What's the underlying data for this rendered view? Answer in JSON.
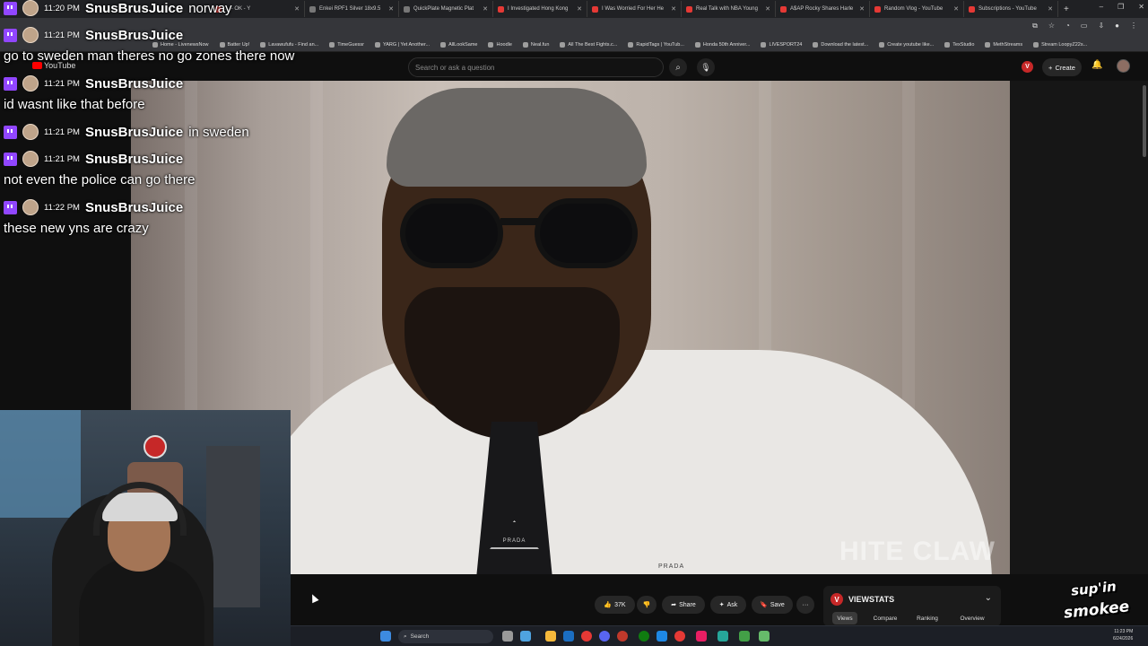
{
  "browser": {
    "tabs": [
      {
        "title": "... - OK - Y",
        "icon": "youtube-favicon"
      },
      {
        "title": "Enkei RPF1 Silver 18x9.5",
        "icon": "page-favicon"
      },
      {
        "title": "QuickPlate Magnetic Plat",
        "icon": "page-favicon"
      },
      {
        "title": "I Investigated Hong Kong",
        "icon": "youtube-favicon"
      },
      {
        "title": "I Was Worried For Her He",
        "icon": "youtube-favicon"
      },
      {
        "title": "Real Talk with NBA Young",
        "icon": "youtube-favicon"
      },
      {
        "title": "A$AP Rocky Shares Harle",
        "icon": "youtube-favicon"
      },
      {
        "title": "Random Vlog - YouTube",
        "icon": "youtube-favicon"
      },
      {
        "title": "Subscriptions - YouTube",
        "icon": "youtube-favicon"
      }
    ],
    "bookmarks": [
      "Home - LivenewsNow",
      "Batter Up!",
      "Lavawufufu - Find an...",
      "TimeGuessr",
      "YARG | Yet Another...",
      "AllLookSame",
      "Hoodle",
      "Neal.fun",
      "All The Best Fights.c...",
      "RapidTags | YouTub...",
      "Honda 50th Anniver...",
      "LIVESPORT24",
      "Download the latest...",
      "Create youtube like...",
      "TexStudio",
      "MethStreams",
      "Stream LoopyZ22s..."
    ]
  },
  "youtube": {
    "logo_text": "YouTube",
    "search_placeholder": "Search or ask a question",
    "create_label": "Create",
    "actions": {
      "like_count": "37K",
      "share_label": "Share",
      "ask_label": "Ask",
      "save_label": "Save",
      "more_label": "···"
    },
    "video": {
      "watermark": "HITE CLAW",
      "tie_logo": "PRADA",
      "pocket_logo": "PRADA"
    }
  },
  "viewstats": {
    "badge": "V",
    "title": "VIEWSTATS",
    "tabs": [
      "Views",
      "Compare",
      "Ranking",
      "Overview"
    ],
    "active_tab": "Views"
  },
  "chat": {
    "messages": [
      {
        "time": "11:20 PM",
        "user": "SnusBrusJuice",
        "inline": "norway",
        "text": ""
      },
      {
        "time": "11:21 PM",
        "user": "SnusBrusJuice",
        "inline": "",
        "text": "go to sweden man theres no go zones there now"
      },
      {
        "time": "11:21 PM",
        "user": "SnusBrusJuice",
        "inline": "",
        "text": "id wasnt like that before"
      },
      {
        "time": "11:21 PM",
        "user": "SnusBrusJuice",
        "inline": "in sweden",
        "text": ""
      },
      {
        "time": "11:21 PM",
        "user": "SnusBrusJuice",
        "inline": "",
        "text": "not even the police can go there"
      },
      {
        "time": "11:22 PM",
        "user": "SnusBrusJuice",
        "inline": "",
        "text": "these new yns are crazy"
      }
    ]
  },
  "taskbar": {
    "search_label": "Search",
    "clock_time": "11:23 PM",
    "clock_date": "6/24/2026"
  },
  "channel_logo": {
    "line1": "sup'in",
    "line2": "smokee"
  },
  "colors": {
    "youtube_red": "#ff0000",
    "twitch_purple": "#9146ff",
    "viewstats_red": "#c62828"
  }
}
